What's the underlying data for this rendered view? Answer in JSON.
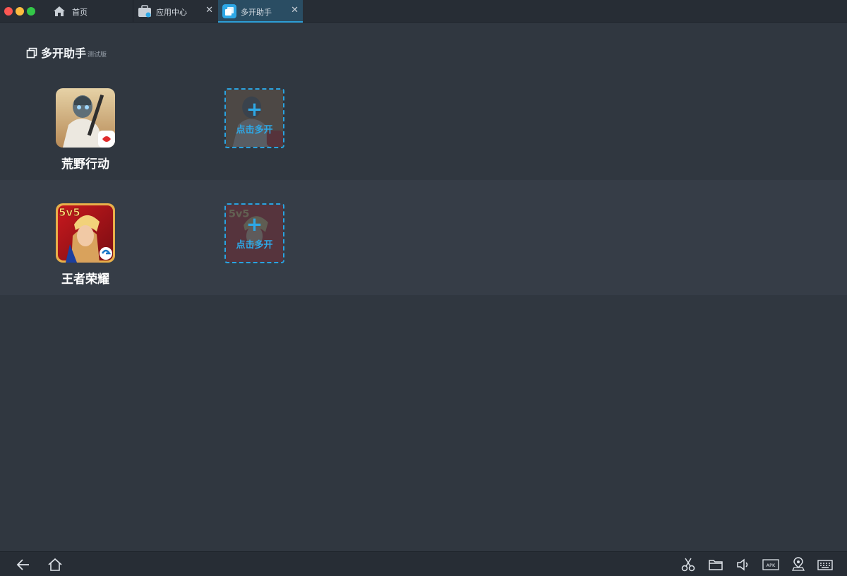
{
  "tabs": [
    {
      "label": "首页",
      "icon": "home-icon",
      "active": false,
      "closable": false
    },
    {
      "label": "应用中心",
      "icon": "app-center-icon",
      "active": false,
      "closable": true
    },
    {
      "label": "多开助手",
      "icon": "multi-instance-icon",
      "active": true,
      "closable": true
    }
  ],
  "tab_close_glyph": "✕",
  "heading": {
    "title": "多开助手",
    "badge": "测试版"
  },
  "apps": [
    {
      "name": "荒野行动",
      "icon": "knives-out-game-icon",
      "clone_label": "点击多开",
      "clone_plus": "+"
    },
    {
      "name": "王者荣耀",
      "icon": "honor-of-kings-game-icon",
      "clone_label": "点击多开",
      "clone_plus": "+",
      "icon_badge": "5v5"
    }
  ],
  "bottom_bar": {
    "left": [
      "back-arrow-icon",
      "home-icon"
    ],
    "right": [
      "scissors-icon",
      "folder-icon",
      "volume-icon",
      "apk-install-icon",
      "location-icon",
      "keyboard-icon"
    ],
    "apk_text": "APK"
  },
  "colors": {
    "background": "#303740",
    "accent": "#2ea8e6",
    "active_tab": "#2a4d63",
    "row_alt": "#363d47"
  }
}
